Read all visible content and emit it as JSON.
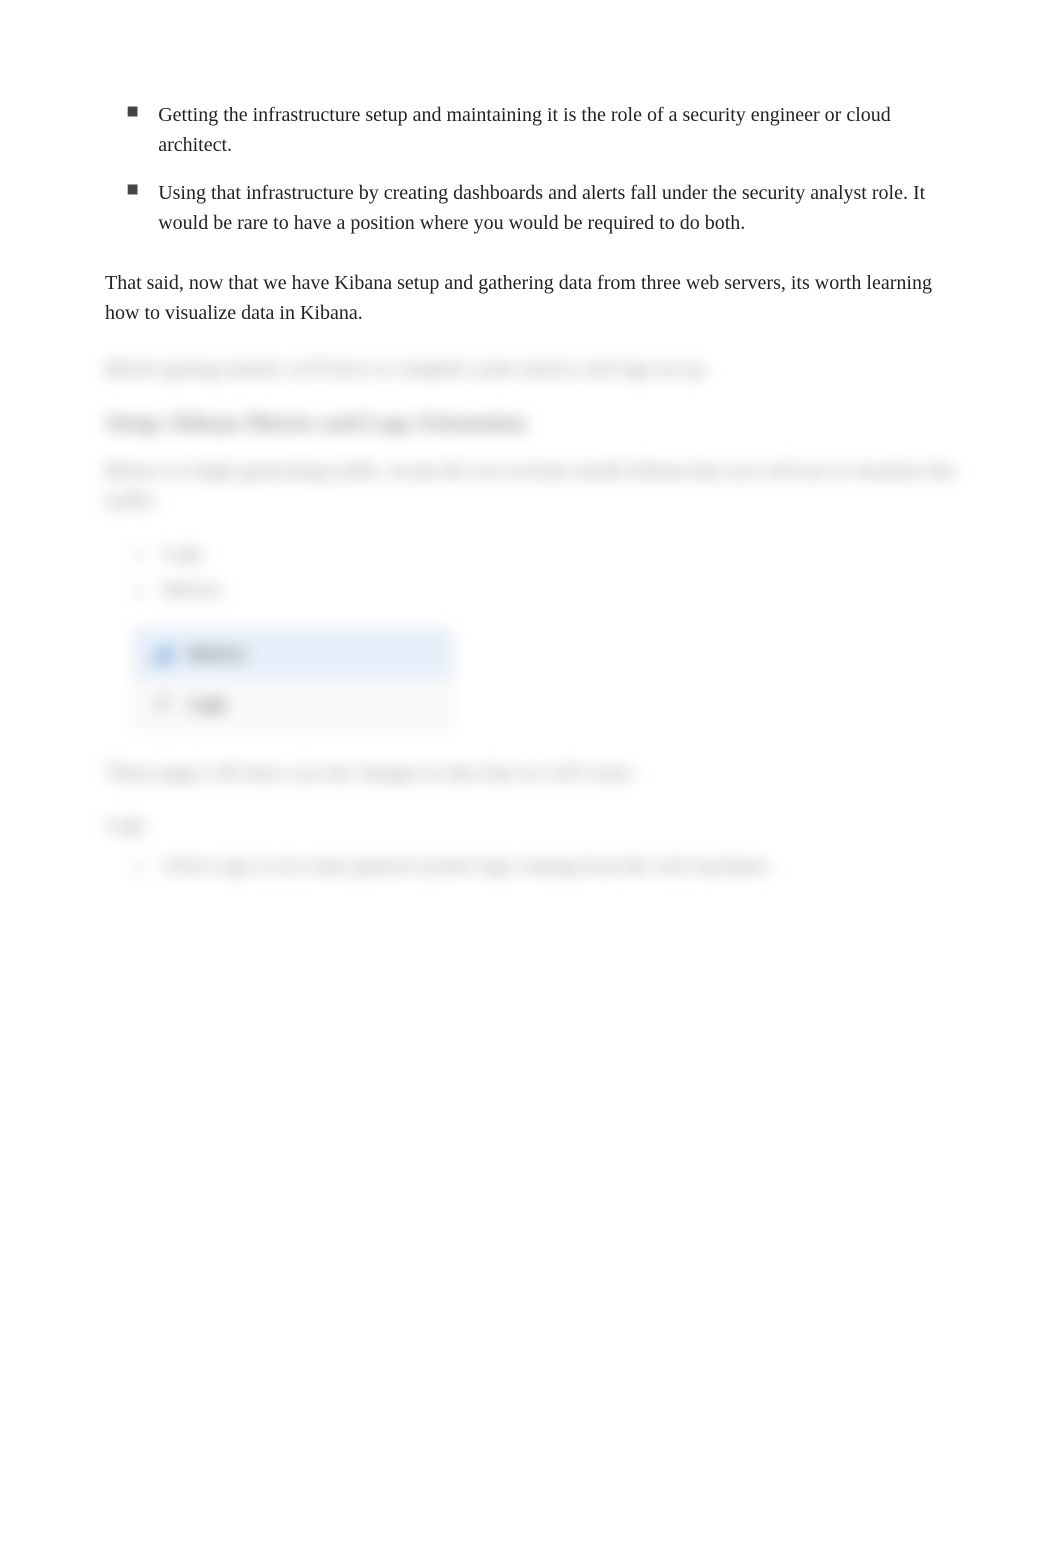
{
  "visible": {
    "bullets": [
      "Getting the infrastructure setup and maintaining it is the role of a security engineer or cloud architect.",
      "Using that infrastructure by creating dashboards and alerts fall under the security analyst role. It would be rare to have a position where you would be required to do both."
    ],
    "paragraph": "That said, now that we have Kibana setup and gathering data from three web servers, its worth learning how to visualize data in Kibana."
  },
  "blurred": {
    "intro": "Before getting started, we'll have to complete some metrics and logs set up.",
    "heading": "Setup: Kibana Metrics and Logs Orientation",
    "setup_paragraph": "Before we begin generating traffic, locate the two sections inside Kibana that you will use to visualize this traffic:",
    "setup_items": [
      "Logs",
      "Metrics"
    ],
    "nav": {
      "metrics": "Metrics",
      "logs": "Logs"
    },
    "pages_paragraph": "These pages will show you the changes in data that we will create.",
    "logs_label": "Logs",
    "logs_bullets": [
      "Click Logs to see some general system logs coming from the web machines."
    ]
  }
}
